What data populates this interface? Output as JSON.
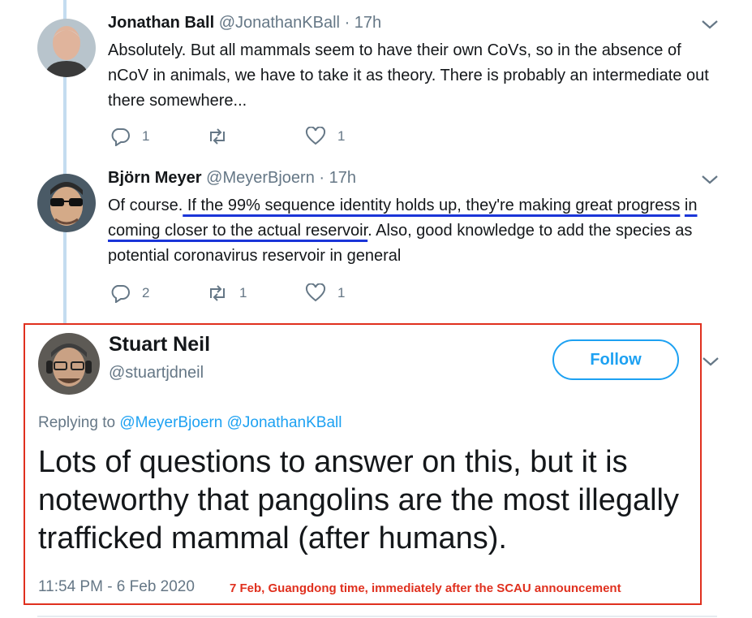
{
  "replies": [
    {
      "author": "Jonathan Ball",
      "handle": "@JonathanKBall",
      "time": "· 17h",
      "text": "Absolutely. But all mammals seem to have their own CoVs, so in the absence of nCoV in animals, we have to take it as theory. There is probably an intermediate out there somewhere...",
      "reply_count": "1",
      "retweet_count": "",
      "like_count": "1"
    },
    {
      "author": "Björn Meyer",
      "handle": "@MeyerBjoern",
      "time": "· 17h",
      "text_before": "Of course.",
      "text_underlined_1": " If the 99% sequence identity holds up, they're making great progress",
      "text_underlined_2": "in coming closer to the actual reservoir",
      "text_after": ". Also, good knowledge to add the species as potential coronavirus reservoir in general",
      "reply_count": "2",
      "retweet_count": "1",
      "like_count": "1"
    }
  ],
  "main_tweet": {
    "author": "Stuart Neil",
    "handle": "@stuartjdneil",
    "follow_label": "Follow",
    "replying_prefix": "Replying to",
    "replying_to": [
      "@MeyerBjoern",
      "@JonathanKBall"
    ],
    "text": "Lots of questions to answer on this, but it is noteworthy that pangolins are the most illegally trafficked mammal (after humans).",
    "timestamp": "11:54 PM - 6 Feb 2020",
    "annotation": "7 Feb, Guangdong time, immediately after the SCAU announcement"
  },
  "colors": {
    "accent": "#1da1f2",
    "annotation_red": "#e0301e",
    "underline_blue": "#1a35d8",
    "thread_line": "#c4dcf0",
    "secondary_text": "#657786"
  },
  "icons": [
    "reply-icon",
    "retweet-icon",
    "like-icon",
    "chevron-down-icon"
  ]
}
